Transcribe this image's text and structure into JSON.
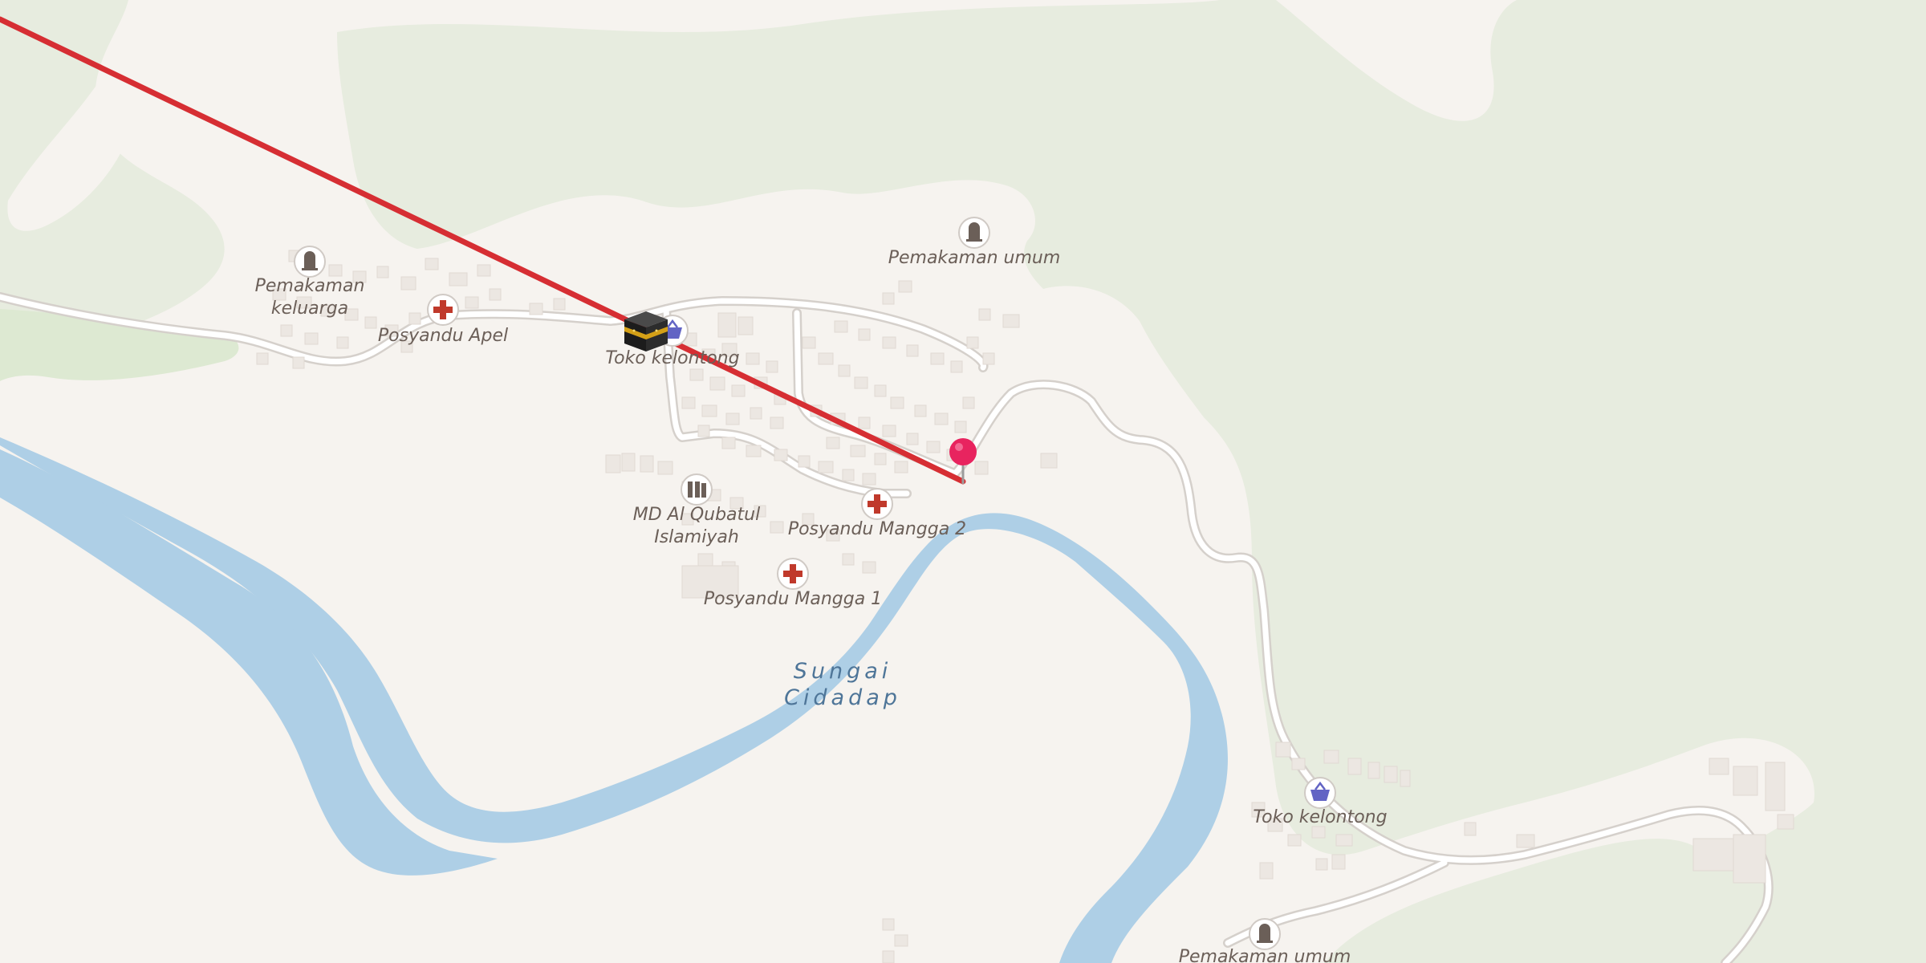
{
  "map": {
    "colors": {
      "land": "#f6f3ef",
      "forest": "#e7ecdf",
      "forest_light": "#dde9d2",
      "water": "#aecfe6",
      "water_label": "#4e7598",
      "road": "#ffffff",
      "road_casing": "#d5d0cb",
      "route_line": "#d62e33",
      "pin": "#e8245f",
      "health_icon": "#c0392b",
      "shop_icon": "#6264c4",
      "cemetery_icon": "#6b5f58",
      "label_text": "#6b5f58"
    },
    "water_label": {
      "line1": "Sungai",
      "line2": "Cidadap"
    },
    "pois": [
      {
        "icon": "cemetery-icon",
        "label_lines": [
          "Pemakaman",
          "keluarga"
        ]
      },
      {
        "icon": "health-cross-icon",
        "label_lines": [
          "Posyandu Apel"
        ]
      },
      {
        "icon": "shop-basket-icon",
        "label_lines": [
          "Toko kelontong"
        ]
      },
      {
        "icon": "cemetery-icon",
        "label_lines": [
          "Pemakaman umum"
        ]
      },
      {
        "icon": "school-icon",
        "label_lines": [
          "MD Al Qubatul",
          "Islamiyah"
        ]
      },
      {
        "icon": "health-cross-icon",
        "label_lines": [
          "Posyandu Mangga 2"
        ]
      },
      {
        "icon": "health-cross-icon",
        "label_lines": [
          "Posyandu Mangga 1"
        ]
      },
      {
        "icon": "shop-basket-icon",
        "label_lines": [
          "Toko kelontong"
        ]
      },
      {
        "icon": "cemetery-icon",
        "label_lines": [
          "Pemakaman umum"
        ]
      }
    ],
    "markers": {
      "kaaba": "kaaba-icon",
      "location_pin": "location-pin-icon",
      "route": "qibla-direction-line"
    }
  }
}
